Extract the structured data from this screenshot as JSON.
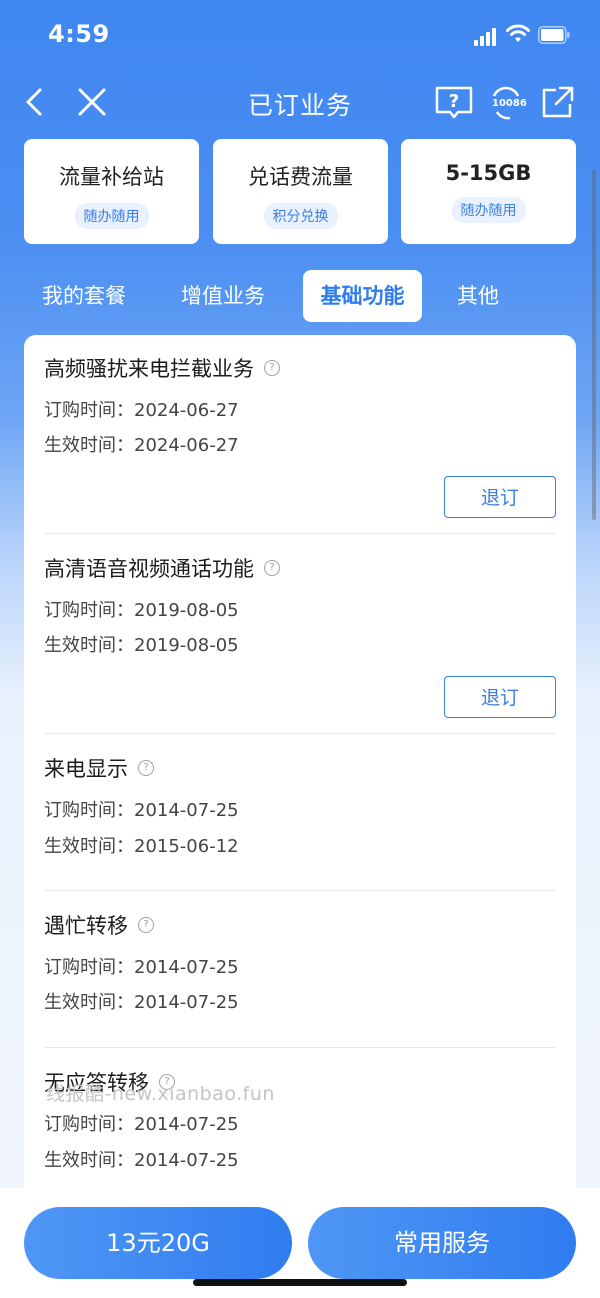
{
  "status_bar": {
    "time": "4:59"
  },
  "nav": {
    "title": "已订业务",
    "hotline": "10086"
  },
  "top_cards": [
    {
      "title": "流量补给站",
      "badge": "随办随用"
    },
    {
      "title": "兑话费流量",
      "badge": "积分兑换"
    },
    {
      "title": "5-15GB",
      "badge": "随办随用"
    }
  ],
  "tabs": [
    {
      "label": "我的套餐",
      "active": false
    },
    {
      "label": "增值业务",
      "active": false
    },
    {
      "label": "基础功能",
      "active": true
    },
    {
      "label": "其他",
      "active": false
    }
  ],
  "services": [
    {
      "name": "高频骚扰来电拦截业务",
      "order_label": "订购时间：",
      "order_date": "2024-06-27",
      "effective_label": "生效时间：",
      "effective_date": "2024-06-27",
      "action": "退订"
    },
    {
      "name": "高清语音视频通话功能",
      "order_label": "订购时间：",
      "order_date": "2019-08-05",
      "effective_label": "生效时间：",
      "effective_date": "2019-08-05",
      "action": "退订"
    },
    {
      "name": "来电显示",
      "order_label": "订购时间：",
      "order_date": "2014-07-25",
      "effective_label": "生效时间：",
      "effective_date": "2015-06-12"
    },
    {
      "name": "遇忙转移",
      "order_label": "订购时间：",
      "order_date": "2014-07-25",
      "effective_label": "生效时间：",
      "effective_date": "2014-07-25"
    },
    {
      "name": "无应答转移",
      "order_label": "订购时间：",
      "order_date": "2014-07-25",
      "effective_label": "生效时间：",
      "effective_date": "2014-07-25"
    }
  ],
  "help_glyph": "?",
  "watermark": "线报酷-new.xianbao.fun",
  "bottom": {
    "left_button": "13元20G",
    "right_button": "常用服务"
  },
  "colors": {
    "primary": "#2f7cf0",
    "header": "#3f86f0"
  }
}
